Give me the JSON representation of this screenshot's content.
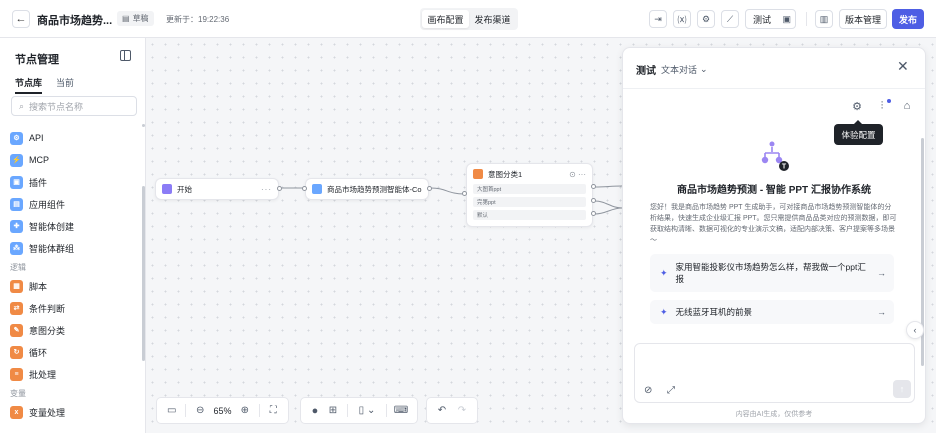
{
  "header": {
    "title": "商品市场趋势...",
    "draft_label": "草稿",
    "updated_text": "更新于：19:22:36",
    "tabs": [
      {
        "label": "画布配置",
        "active": true
      },
      {
        "label": "发布渠道",
        "active": false
      }
    ],
    "test_label": "测试",
    "version_label": "版本管理",
    "publish_label": "发布"
  },
  "sidebar": {
    "title": "节点管理",
    "tabs": [
      {
        "label": "节点库",
        "active": true
      },
      {
        "label": "当前",
        "active": false
      }
    ],
    "search_placeholder": "搜索节点名称",
    "items": [
      {
        "label": "API",
        "icon": "api-icon",
        "color": "#6aa7ff",
        "glyph": "⚙"
      },
      {
        "label": "MCP",
        "icon": "mcp-icon",
        "color": "#6aa7ff",
        "glyph": "⚡"
      },
      {
        "label": "插件",
        "icon": "plugin-icon",
        "color": "#6aa7ff",
        "glyph": "▣"
      },
      {
        "label": "应用组件",
        "icon": "app-component-icon",
        "color": "#6aa7ff",
        "glyph": "▤"
      },
      {
        "label": "智能体创建",
        "icon": "agent-create-icon",
        "color": "#6aa7ff",
        "glyph": "✚"
      },
      {
        "label": "智能体群组",
        "icon": "agent-group-icon",
        "color": "#6aa7ff",
        "glyph": "⁂"
      }
    ],
    "section_logic": "逻辑",
    "logic_items": [
      {
        "label": "脚本",
        "icon": "script-icon",
        "color": "#f08a45",
        "glyph": "▦"
      },
      {
        "label": "条件判断",
        "icon": "condition-icon",
        "color": "#f08a45",
        "glyph": "⇄"
      },
      {
        "label": "意图分类",
        "icon": "intent-icon",
        "color": "#f08a45",
        "glyph": "✎"
      },
      {
        "label": "循环",
        "icon": "loop-icon",
        "color": "#f08a45",
        "glyph": "↻"
      },
      {
        "label": "批处理",
        "icon": "batch-icon",
        "color": "#f08a45",
        "glyph": "≡"
      }
    ],
    "section_variable": "变量",
    "variable_items": [
      {
        "label": "变量处理",
        "icon": "variable-icon",
        "color": "#f08a45",
        "glyph": "x"
      }
    ]
  },
  "canvas": {
    "nodes": {
      "start": {
        "label": "开始",
        "color": "#8b7cf6"
      },
      "agent": {
        "label": "商品市场趋势预测智能体-Com...",
        "color": "#6aa7ff"
      },
      "intent": {
        "label": "意图分类1",
        "color": "#f08a45",
        "options": [
          "大图首ppt",
          "完第ppt",
          "默认"
        ]
      }
    },
    "zoom": "65%"
  },
  "test_panel": {
    "title": "测试",
    "mode": "文本对话",
    "tooltip": "体验配置",
    "agent_name": "商品市场趋势预测 - 智能 PPT 汇报协作系统",
    "description": "您好！我是商品市场趋势 PPT 生成助手，可对接商品市场趋势预测智能体的分析结果，快速生成企业级汇报 PPT。您只需提供商品品类对应的预测数据，即可获取结构清晰、数据可视化的专业演示文稿，适配内部决策、客户提案等多场景～",
    "suggestions": [
      "家用智能投影仪市场趋势怎么样，帮我做一个ppt汇报",
      "无线蓝牙耳机的前景"
    ],
    "footer": "内容由AI生成，仅供参考"
  }
}
